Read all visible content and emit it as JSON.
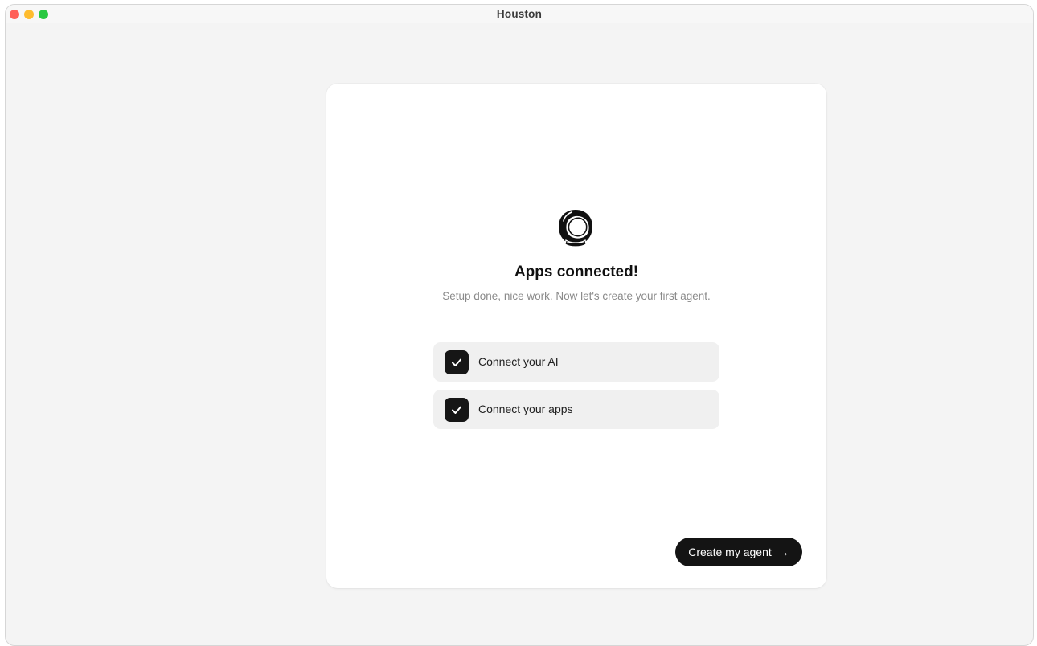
{
  "window": {
    "title": "Houston"
  },
  "onboarding": {
    "logo_icon": "astronaut-helmet-icon",
    "heading": "Apps connected!",
    "subtext": "Setup done, nice work. Now let's create your first agent.",
    "steps": [
      {
        "label": "Connect your AI",
        "checked": true
      },
      {
        "label": "Connect your apps",
        "checked": true
      }
    ],
    "cta_label": "Create my agent",
    "cta_icon": "arrow-right-icon"
  },
  "colors": {
    "background": "#f4f4f4",
    "card": "#ffffff",
    "accent": "#141414",
    "step_bg": "#f0f0f0",
    "muted_text": "#8a8a8a"
  }
}
